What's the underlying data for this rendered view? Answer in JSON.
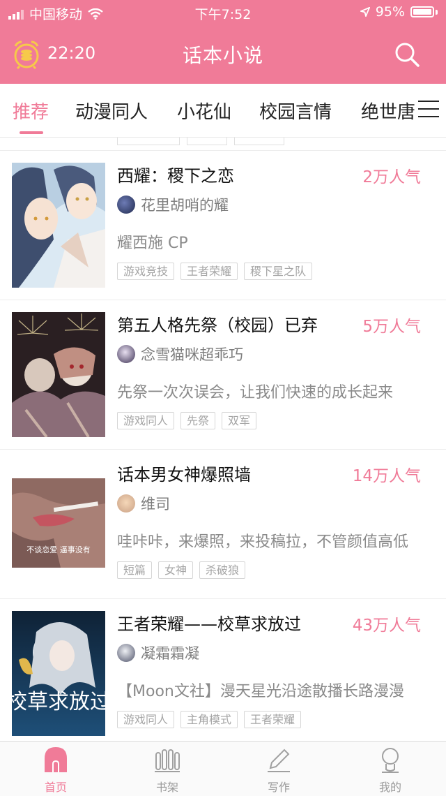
{
  "status_bar": {
    "carrier": "中国移动",
    "time": "下午7:52",
    "battery": "95%"
  },
  "nav": {
    "time": "22:20",
    "title": "话本小说"
  },
  "tabs": [
    {
      "label": "推荐",
      "active": true
    },
    {
      "label": "动漫同人"
    },
    {
      "label": "小花仙"
    },
    {
      "label": "校园言情"
    },
    {
      "label": "绝世唐"
    }
  ],
  "books": [
    {
      "title": "西耀：稷下之恋",
      "popularity": "2万人气",
      "author": "花里胡哨的耀",
      "description": "耀西施 CP",
      "tags": [
        "游戏竞技",
        "王者荣耀",
        "稷下星之队"
      ]
    },
    {
      "title": "第五人格先祭（校园）已弃",
      "popularity": "5万人气",
      "author": "念雪猫咪超乖巧",
      "description": "先祭一次次误会，让我们快速的成长起来",
      "tags": [
        "游戏同人",
        "先祭",
        "双军"
      ]
    },
    {
      "title": "话本男女神爆照墙",
      "popularity": "14万人气",
      "author": "维司",
      "description": "哇咔咔，来爆照，来投稿拉，不管颜值高低",
      "tags": [
        "短篇",
        "女神",
        "杀破狼"
      ],
      "cover_caption": "不谈恋爱 逼事没有"
    },
    {
      "title": "王者荣耀——校草求放过",
      "popularity": "43万人气",
      "author": "凝霜霜凝",
      "description": "【Moon文社】漫天星光沿途散播长路漫漫",
      "tags": [
        "游戏同人",
        "主角模式",
        "王者荣耀"
      ],
      "cover_caption": "校草求放过"
    }
  ],
  "bottom_nav": [
    {
      "label": "首页",
      "icon": "home-icon",
      "active": true
    },
    {
      "label": "书架",
      "icon": "bookshelf-icon"
    },
    {
      "label": "写作",
      "icon": "pen-icon"
    },
    {
      "label": "我的",
      "icon": "profile-icon"
    }
  ],
  "colors": {
    "accent": "#f07b98",
    "text_primary": "#111111",
    "text_secondary": "#8a8a8a"
  }
}
